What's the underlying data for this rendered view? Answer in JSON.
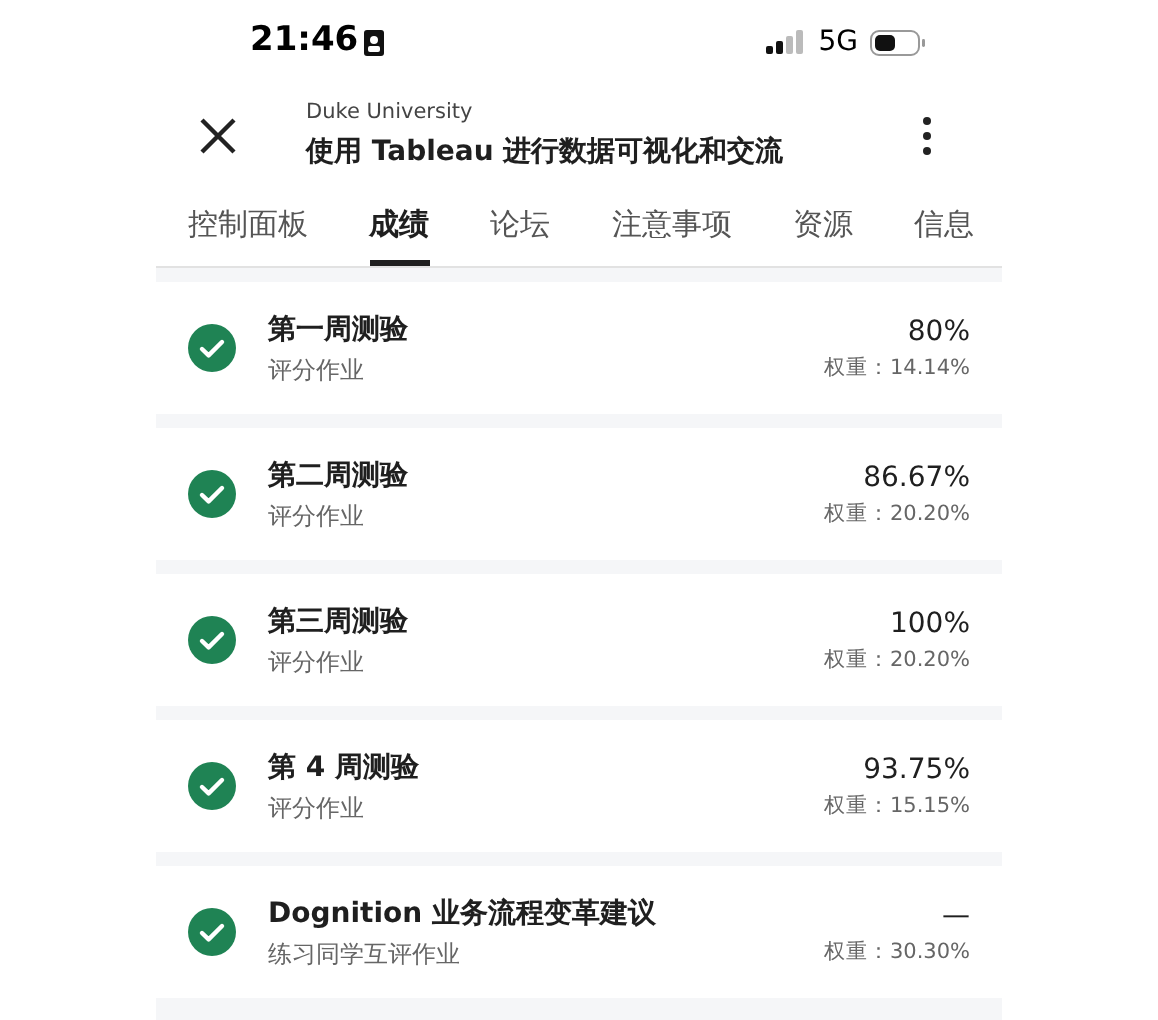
{
  "status_bar": {
    "time": "21:46"
  },
  "status_bar_network": "5G",
  "header": {
    "subtitle": "Duke University",
    "title": "使用 Tableau 进行数据可视化和交流"
  },
  "tabs": [
    {
      "label": "控制面板",
      "selected": false
    },
    {
      "label": "成绩",
      "selected": true
    },
    {
      "label": "论坛",
      "selected": false
    },
    {
      "label": "注意事项",
      "selected": false
    },
    {
      "label": "资源",
      "selected": false
    },
    {
      "label": "信息",
      "selected": false
    }
  ],
  "assignments": [
    {
      "title": "第一周测验",
      "type": "评分作业",
      "score": "80%",
      "weight": "权重：14.14%",
      "completed": true
    },
    {
      "title": "第二周测验",
      "type": "评分作业",
      "score": "86.67%",
      "weight": "权重：20.20%",
      "completed": true
    },
    {
      "title": "第三周测验",
      "type": "评分作业",
      "score": "100%",
      "weight": "权重：20.20%",
      "completed": true
    },
    {
      "title": "第 4 周测验",
      "type": "评分作业",
      "score": "93.75%",
      "weight": "权重：15.15%",
      "completed": true
    },
    {
      "title": "Dognition 业务流程变革建议",
      "type": "练习同学互评作业",
      "score": "—",
      "weight": "权重：30.30%",
      "completed": true
    }
  ]
}
